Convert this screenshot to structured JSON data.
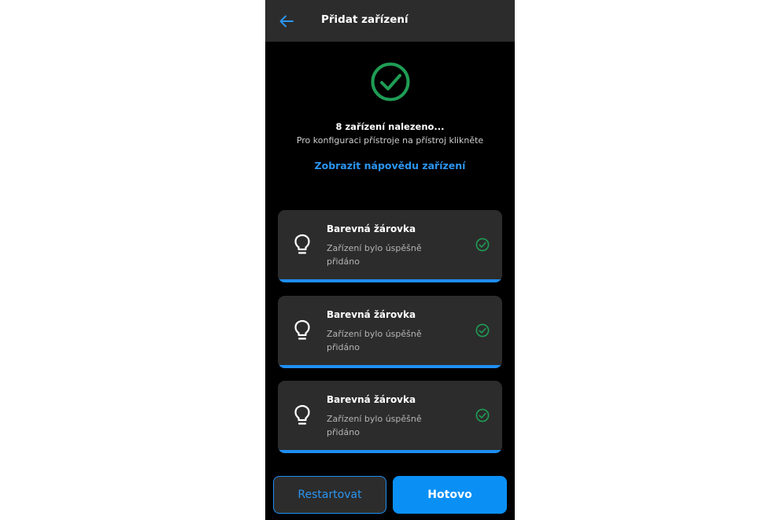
{
  "appbar": {
    "title": "Přidat zařízení",
    "back_icon": "arrow-left-icon"
  },
  "status": {
    "icon": "check-circle-icon",
    "found_text": "8 zařízení nalezeno...",
    "instruction": "Pro konfiguraci přístroje na přístroj klikněte",
    "help_link": "Zobrazit nápovědu zařízení"
  },
  "devices": [
    {
      "name": "Barevná žárovka",
      "status": "Zařízení bylo úspěšně přidáno",
      "icon": "lightbulb-icon",
      "state_icon": "check-circle-icon"
    },
    {
      "name": "Barevná žárovka",
      "status": "Zařízení bylo úspěšně přidáno",
      "icon": "lightbulb-icon",
      "state_icon": "check-circle-icon"
    },
    {
      "name": "Barevná žárovka",
      "status": "Zařízení bylo úspěšně přidáno",
      "icon": "lightbulb-icon",
      "state_icon": "check-circle-icon"
    }
  ],
  "footer": {
    "restart_label": "Restartovat",
    "done_label": "Hotovo"
  },
  "colors": {
    "accent": "#1f8ef1",
    "success": "#1f9d55",
    "background": "#000000",
    "surface": "#2c2c2c"
  }
}
